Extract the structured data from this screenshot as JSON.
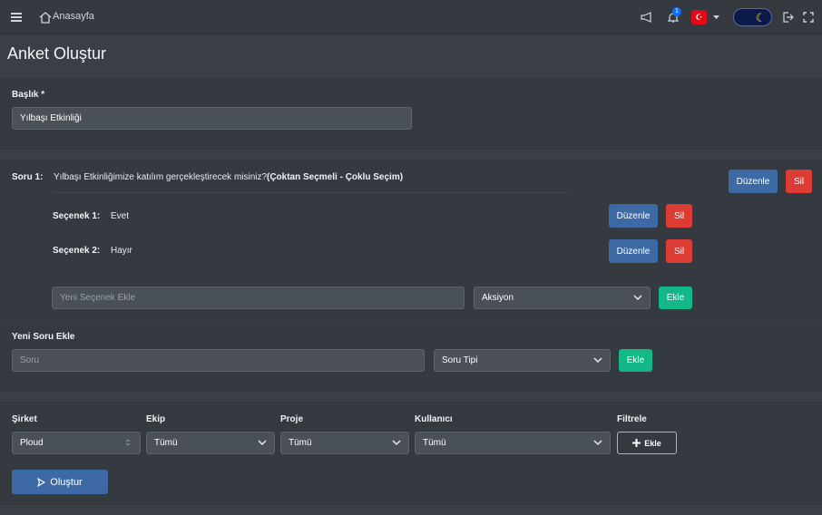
{
  "topbar": {
    "home_label": "Anasayfa",
    "notification_count": "1",
    "flag_symbol": "☪"
  },
  "page": {
    "title": "Anket Oluştur"
  },
  "form": {
    "title_label": "Başlık *",
    "title_value": "Yılbaşı Etkinliği"
  },
  "question": {
    "label": "Soru 1:",
    "text": "Yılbaşı Etkinliğimize katılım gerçekleştirecek misiniz?",
    "type": "(Çoktan Seçmeli - Çoklu Seçim)",
    "edit_label": "Düzenle",
    "delete_label": "Sil",
    "options": [
      {
        "label": "Seçenek 1:",
        "value": "Evet",
        "edit_label": "Düzenle",
        "delete_label": "Sil"
      },
      {
        "label": "Seçenek 2:",
        "value": "Hayır",
        "edit_label": "Düzenle",
        "delete_label": "Sil"
      }
    ],
    "new_option_placeholder": "Yeni Seçenek Ekle",
    "action_select": "Aksiyon",
    "add_option_label": "Ekle"
  },
  "new_question": {
    "label": "Yeni Soru Ekle",
    "placeholder": "Soru",
    "type_select": "Soru Tipi",
    "add_label": "Ekle"
  },
  "filters": {
    "company": {
      "label": "Şirket",
      "value": "Ploud"
    },
    "team": {
      "label": "Ekip",
      "value": "Tümü"
    },
    "project": {
      "label": "Proje",
      "value": "Tümü"
    },
    "user": {
      "label": "Kullanıcı",
      "value": "Tümü"
    },
    "filter": {
      "label": "Filtrele",
      "button": "Ekle"
    }
  },
  "submit_label": "Oluştur",
  "colors": {
    "edit": "#3d6aa5",
    "delete": "#dc3c33",
    "add": "#12b886"
  }
}
